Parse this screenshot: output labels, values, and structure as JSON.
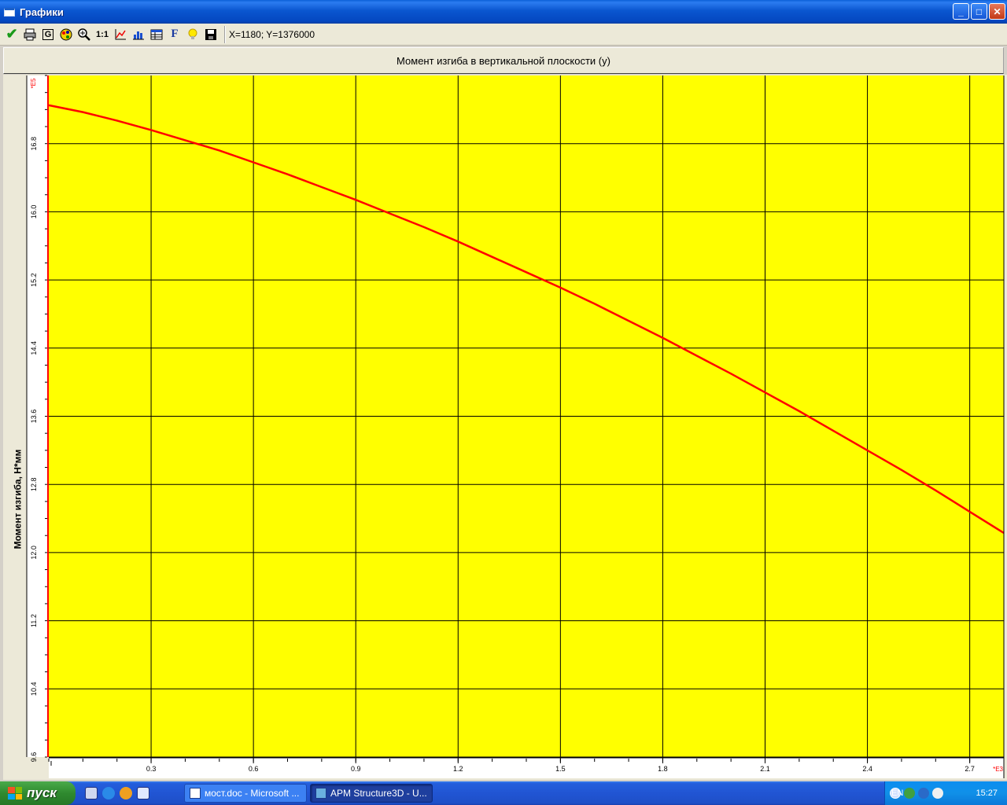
{
  "window": {
    "title": "Графики"
  },
  "window_buttons": {
    "minimize": "_",
    "maximize": "□",
    "close": "✕"
  },
  "toolbar": {
    "buttons": [
      {
        "name": "apply-icon",
        "glyph": "✔"
      },
      {
        "name": "print-icon",
        "glyph": ""
      },
      {
        "name": "grid-g-icon",
        "glyph": "G"
      },
      {
        "name": "palette-icon",
        "glyph": ""
      },
      {
        "name": "zoom-icon",
        "glyph": ""
      },
      {
        "name": "scale-1to1-icon",
        "glyph": "1:1"
      },
      {
        "name": "axes-icon",
        "glyph": ""
      },
      {
        "name": "histogram-icon",
        "glyph": ""
      },
      {
        "name": "table-icon",
        "glyph": ""
      },
      {
        "name": "font-icon",
        "glyph": "F"
      },
      {
        "name": "hint-icon",
        "glyph": ""
      },
      {
        "name": "save-icon",
        "glyph": ""
      }
    ],
    "coords": "X=1180;  Y=1376000"
  },
  "chart_header": "Момент изгиба в вертикальной плоскости (y)",
  "chart_data": {
    "type": "line",
    "ylabel": "Момент изгиба, Н*мм",
    "x_multiplier": "*E3",
    "y_multiplier": "*E5",
    "xlim": [
      0,
      2.8
    ],
    "ylim": [
      9.6,
      17.6
    ],
    "x_ticks": [
      "0.3",
      "0.6",
      "0.9",
      "1.2",
      "1.5",
      "1.8",
      "2.1",
      "2.4",
      "2.7"
    ],
    "x_tick_values": [
      0.3,
      0.6,
      0.9,
      1.2,
      1.5,
      1.8,
      2.1,
      2.4,
      2.7
    ],
    "y_ticks": [
      "16.8",
      "16.0",
      "15.2",
      "14.4",
      "13.6",
      "12.8",
      "12.0",
      "11.2",
      "10.4",
      "9.6"
    ],
    "y_tick_values": [
      16.8,
      16.0,
      15.2,
      14.4,
      13.6,
      12.8,
      12.0,
      11.2,
      10.4,
      9.6
    ],
    "grid": true,
    "background": "#ffff00",
    "series": [
      {
        "color": "#ff0000",
        "x": [
          0,
          0.1,
          0.2,
          0.3,
          0.4,
          0.5,
          0.6,
          0.7,
          0.8,
          0.9,
          1.0,
          1.1,
          1.2,
          1.3,
          1.4,
          1.5,
          1.6,
          1.7,
          1.8,
          1.9,
          2.0,
          2.1,
          2.2,
          2.3,
          2.4,
          2.5,
          2.6,
          2.7,
          2.8
        ],
        "y": [
          17.25,
          17.17,
          17.07,
          16.96,
          16.84,
          16.72,
          16.58,
          16.44,
          16.29,
          16.14,
          15.98,
          15.82,
          15.65,
          15.47,
          15.29,
          15.11,
          14.92,
          14.72,
          14.52,
          14.31,
          14.1,
          13.88,
          13.66,
          13.43,
          13.2,
          12.97,
          12.73,
          12.48,
          12.23
        ]
      }
    ]
  },
  "taskbar": {
    "start_label": "пуск",
    "tasks": [
      "мост.doc - Microsoft ...",
      "APM Structure3D - U..."
    ],
    "lang": "EN",
    "clock": "15:27"
  }
}
